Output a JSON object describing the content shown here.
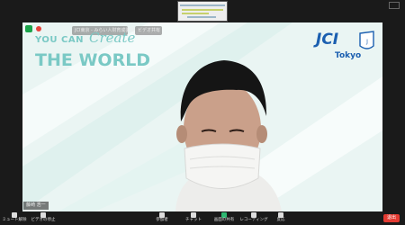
{
  "meeting": {
    "badges": [
      "JCI東京 - みらい人財育成委員会",
      "ビデオ共有"
    ],
    "participant_name": "藤崎 浩一"
  },
  "background": {
    "line1": "YOU CAN",
    "line1_script": "Create",
    "line2": "THE WORLD",
    "brand": "JCI",
    "brand_sub": "Tokyo"
  },
  "toolbar": {
    "mute": "ミュート解除",
    "video": "ビデオの停止",
    "participants": "参加者",
    "participants_count": "42",
    "chat": "チャット",
    "share": "画面の共有",
    "record": "レコーディング",
    "reactions": "反応",
    "end": "退出"
  }
}
